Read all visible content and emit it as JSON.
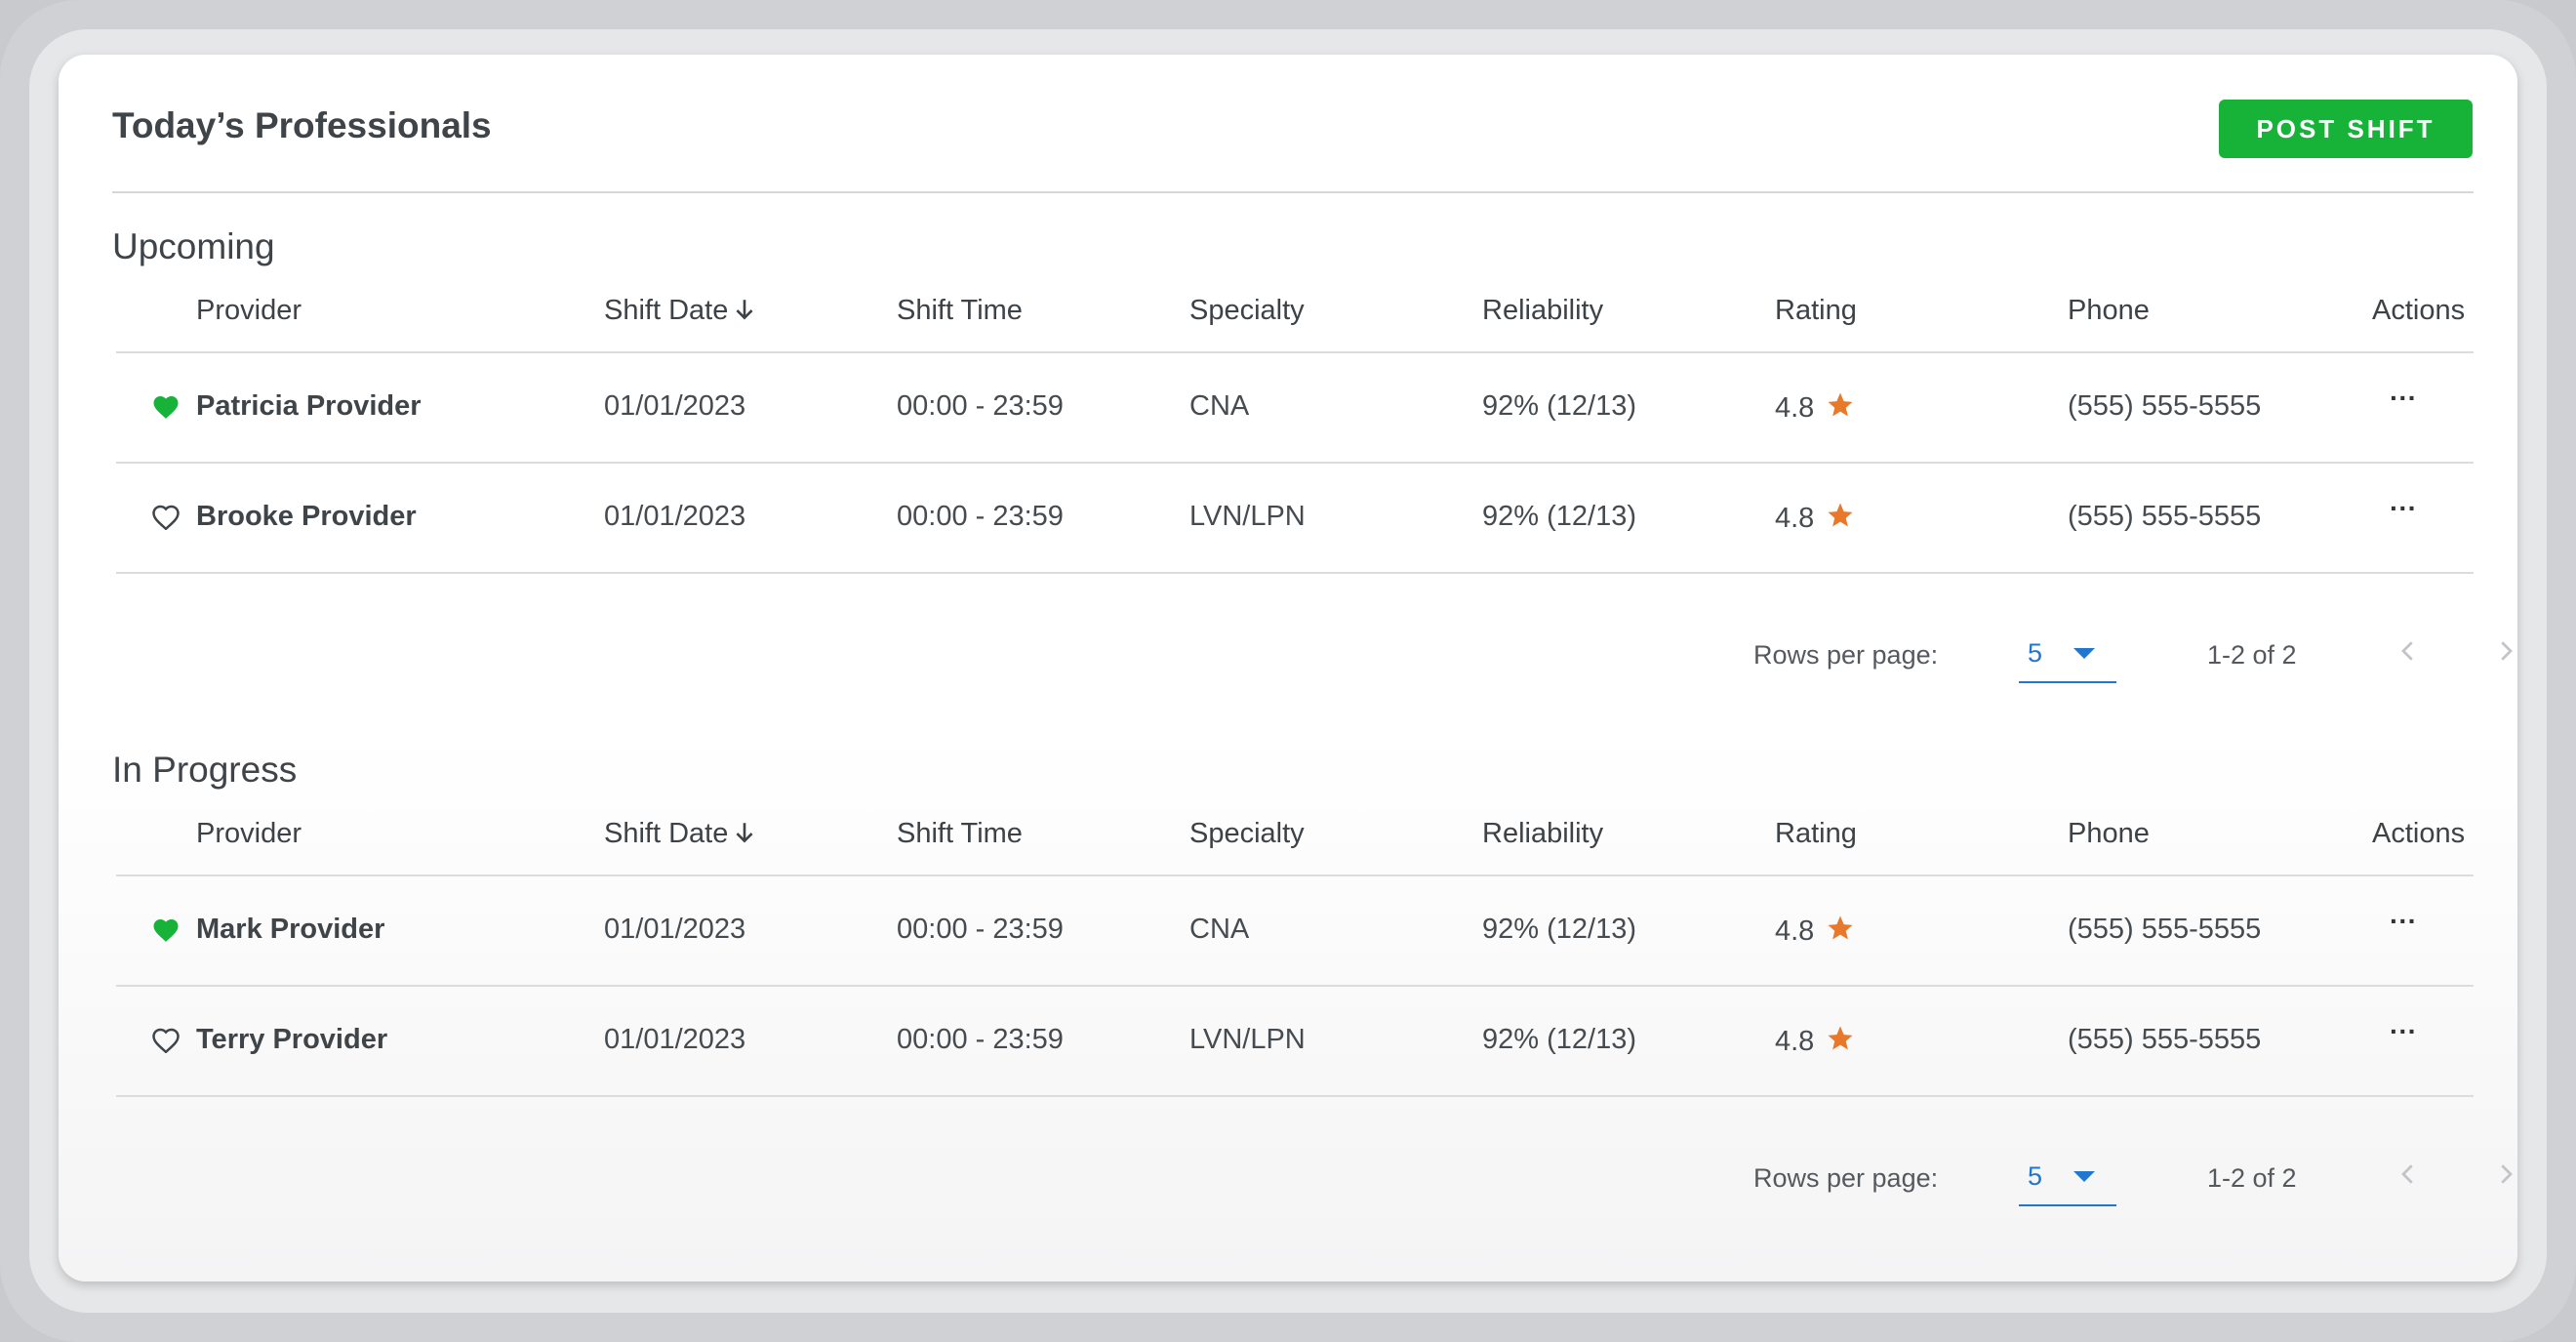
{
  "header": {
    "title": "Today’s Professionals",
    "post_button": "POST SHIFT"
  },
  "columns": [
    "Provider",
    "Shift Date",
    "Shift Time",
    "Specialty",
    "Reliability",
    "Rating",
    "Phone",
    "Actions"
  ],
  "sections": [
    {
      "title": "Upcoming",
      "rows": [
        {
          "provider": "Patricia Provider",
          "favorite": true,
          "date": "01/01/2023",
          "time": "00:00 - 23:59",
          "specialty": "CNA",
          "reliability": "92% (12/13)",
          "rating": "4.8",
          "phone": "(555) 555-5555"
        },
        {
          "provider": "Brooke Provider",
          "favorite": false,
          "date": "01/01/2023",
          "time": "00:00 - 23:59",
          "specialty": "LVN/LPN",
          "reliability": "92% (12/13)",
          "rating": "4.8",
          "phone": "(555) 555-5555"
        }
      ],
      "pagination": {
        "rows_label": "Rows per page:",
        "rows_per_page": "5",
        "range": "1-2 of 2"
      }
    },
    {
      "title": "In Progress",
      "rows": [
        {
          "provider": "Mark Provider",
          "favorite": true,
          "date": "01/01/2023",
          "time": "00:00 - 23:59",
          "specialty": "CNA",
          "reliability": "92% (12/13)",
          "rating": "4.8",
          "phone": "(555) 555-5555"
        },
        {
          "provider": "Terry Provider",
          "favorite": false,
          "date": "01/01/2023",
          "time": "00:00 - 23:59",
          "specialty": "LVN/LPN",
          "reliability": "92% (12/13)",
          "rating": "4.8",
          "phone": "(555) 555-5555"
        }
      ],
      "pagination": {
        "rows_label": "Rows per page:",
        "rows_per_page": "5",
        "range": "1-2 of 2"
      }
    }
  ],
  "actions_glyph": "···",
  "icons": {
    "favorite": "heart-filled-icon",
    "not_favorite": "heart-outline-icon",
    "rating": "star-icon",
    "sort": "arrow-down-icon",
    "prev": "chevron-left-icon",
    "next": "chevron-right-icon"
  },
  "colors": {
    "accent_green": "#17b338",
    "star_orange": "#e8782a",
    "link_blue": "#1f77d0"
  }
}
